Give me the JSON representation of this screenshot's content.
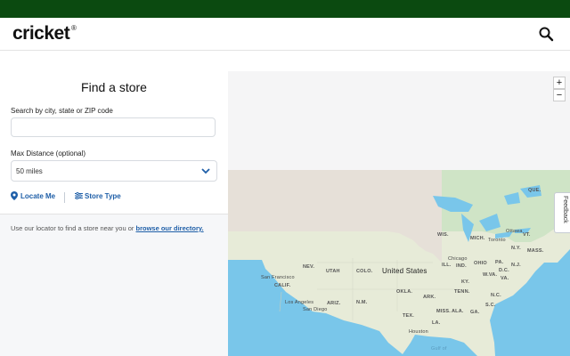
{
  "header": {
    "logo_text": "cricket",
    "search_icon": "search-icon"
  },
  "panel": {
    "title": "Find a store",
    "search_label": "Search by city, state or ZIP code",
    "search_value": "",
    "distance_label": "Max Distance (optional)",
    "distance_value": "50 miles",
    "locate_label": "Locate Me",
    "store_type_label": "Store Type",
    "helper_text": "Use our locator to find a store near you or ",
    "helper_link": "browse our directory."
  },
  "map": {
    "zoom_in": "+",
    "zoom_out": "−",
    "feedback": "Feedback",
    "labels": {
      "country": "United States",
      "que": "QUE.",
      "wis": "WIS.",
      "mich": "MICH.",
      "ottawa": "Ottawa",
      "vt": "VT.",
      "ny": "N.Y.",
      "toronto": "Toronto",
      "mass": "MASS.",
      "chicago": "Chicago",
      "ill": "ILL.",
      "ind": "IND.",
      "ohio": "OHIO",
      "pa": "PA.",
      "dc": "D.C.",
      "nj": "N.J.",
      "wva": "W.VA.",
      "va": "VA.",
      "nev": "NEV.",
      "utah": "UTAH",
      "colo": "COLO.",
      "sf": "San Francisco",
      "calif": "CALIF.",
      "ky": "KY.",
      "tenn": "TENN.",
      "nc": "N.C.",
      "okla": "OKLA.",
      "ark": "ARK.",
      "sc": "S.C.",
      "ariz": "ARIZ.",
      "nm": "N.M.",
      "la": "Los Angeles",
      "sandiego": "San Diego",
      "miss": "MISS.",
      "ala": "ALA.",
      "ga": "GA.",
      "tex": "TEX.",
      "la_state": "LA.",
      "houston": "Houston",
      "gulf": "Gulf of"
    },
    "colors": {
      "water": "#79c6ea",
      "land": "#e7ebd8",
      "canada": "#e6e0d8"
    }
  }
}
